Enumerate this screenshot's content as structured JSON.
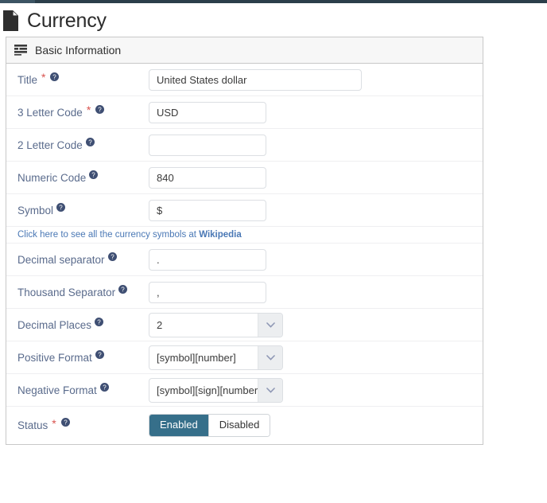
{
  "topbar": {
    "brand_segment": ""
  },
  "page": {
    "title": "Currency",
    "icon": "file-document-icon"
  },
  "panel": {
    "icon": "list-lines-icon",
    "title": "Basic Information"
  },
  "colors": {
    "accent": "#366f8a",
    "label": "#5a6b8c",
    "link": "#4a78b5",
    "required": "#d9534f",
    "navbar": "#2b3e4a",
    "panel_header_bg": "#f7f7f7",
    "border": "#c8c8c8"
  },
  "fields": {
    "title": {
      "label": "Title",
      "required": true,
      "help": "help-icon",
      "value": "United States dollar",
      "placeholder": ""
    },
    "three_letter_code": {
      "label": "3 Letter Code",
      "required": true,
      "help": "help-icon",
      "value": "USD",
      "placeholder": ""
    },
    "two_letter_code": {
      "label": "2 Letter Code",
      "required": false,
      "help": "help-icon",
      "value": "",
      "placeholder": ""
    },
    "numeric_code": {
      "label": "Numeric Code",
      "required": false,
      "help": "help-icon",
      "value": "840",
      "placeholder": ""
    },
    "symbol": {
      "label": "Symbol",
      "required": false,
      "help": "help-icon",
      "value": "$",
      "placeholder": ""
    },
    "decimal_separator": {
      "label": "Decimal separator",
      "required": false,
      "help": "help-icon",
      "value": ".",
      "placeholder": ""
    },
    "thousand_separator": {
      "label": "Thousand Separator",
      "required": false,
      "help": "help-icon",
      "value": ",",
      "placeholder": ""
    },
    "decimal_places": {
      "label": "Decimal Places",
      "required": false,
      "help": "help-icon",
      "value": "2"
    },
    "positive_format": {
      "label": "Positive Format",
      "required": false,
      "help": "help-icon",
      "value": "[symbol][number]"
    },
    "negative_format": {
      "label": "Negative Format",
      "required": false,
      "help": "help-icon",
      "value": "[symbol][sign][number]"
    },
    "status": {
      "label": "Status",
      "required": true,
      "help": "help-icon",
      "enabled_label": "Enabled",
      "disabled_label": "Disabled",
      "selected": "Enabled"
    }
  },
  "symbols_link": {
    "prefix": "Click here to see all the currency symbols at ",
    "target": "Wikipedia"
  }
}
